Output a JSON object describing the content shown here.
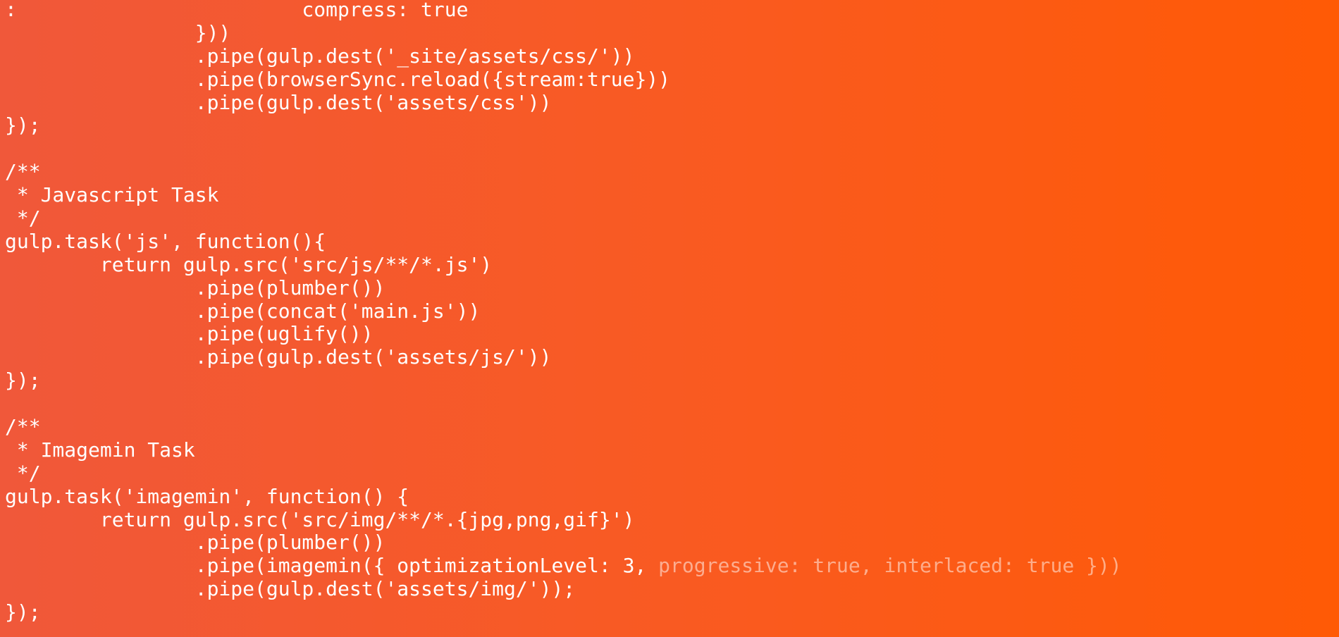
{
  "colors": {
    "background_left": "#f0583a",
    "background_mid": "#f95a22",
    "background_right": "#ff5a05",
    "text": "#ffffff",
    "text_faded": "rgba(255,255,255,0.5)"
  },
  "code": {
    "lines": [
      ":                        compress: true",
      "                }))",
      "                .pipe(gulp.dest('_site/assets/css/'))",
      "                .pipe(browserSync.reload({stream:true}))",
      "                .pipe(gulp.dest('assets/css'))",
      "});",
      "",
      "/**",
      " * Javascript Task",
      " */",
      "gulp.task('js', function(){",
      "        return gulp.src('src/js/**/*.js')",
      "                .pipe(plumber())",
      "                .pipe(concat('main.js'))",
      "                .pipe(uglify())",
      "                .pipe(gulp.dest('assets/js/'))",
      "});",
      "",
      "/**",
      " * Imagemin Task",
      " */",
      "gulp.task('imagemin', function() {",
      "        return gulp.src('src/img/**/*.{jpg,png,gif}')",
      "                .pipe(plumber())",
      "",
      "                .pipe(gulp.dest('assets/img/'));",
      "});"
    ],
    "imagemin_line": {
      "bright": "                .pipe(imagemin({ optimizationLevel: 3, ",
      "faded": "progressive: true, interlaced: true }))"
    }
  }
}
